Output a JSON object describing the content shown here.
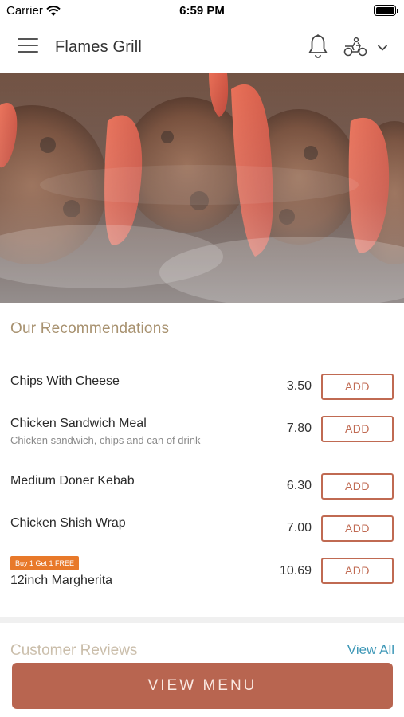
{
  "status_bar": {
    "carrier": "Carrier",
    "time": "6:59 PM"
  },
  "header": {
    "title": "Flames Grill",
    "icons": [
      "menu-icon",
      "bell-icon",
      "delivery-rider-icon",
      "chevron-down-icon"
    ]
  },
  "recommendations": {
    "title": "Our Recommendations",
    "add_label": "ADD",
    "items": [
      {
        "name": "Chips With Cheese",
        "description": "",
        "price": "3.50",
        "badge": ""
      },
      {
        "name": "Chicken Sandwich Meal",
        "description": "Chicken sandwich, chips and can of drink",
        "price": "7.80",
        "badge": ""
      },
      {
        "name": "Medium Doner Kebab",
        "description": "",
        "price": "6.30",
        "badge": ""
      },
      {
        "name": "Chicken Shish Wrap",
        "description": "",
        "price": "7.00",
        "badge": ""
      },
      {
        "name": "12inch Margherita",
        "description": "",
        "price": "10.69",
        "badge": "Buy 1 Get 1 FREE"
      }
    ]
  },
  "reviews": {
    "title": "Customer Reviews",
    "view_all": "View All"
  },
  "footer": {
    "view_menu_label": "VIEW MENU"
  },
  "colors": {
    "accent": "#b86550",
    "add_border": "#c06a52",
    "section_title": "#a89270",
    "link": "#3a96b6",
    "badge": "#e8792a"
  }
}
